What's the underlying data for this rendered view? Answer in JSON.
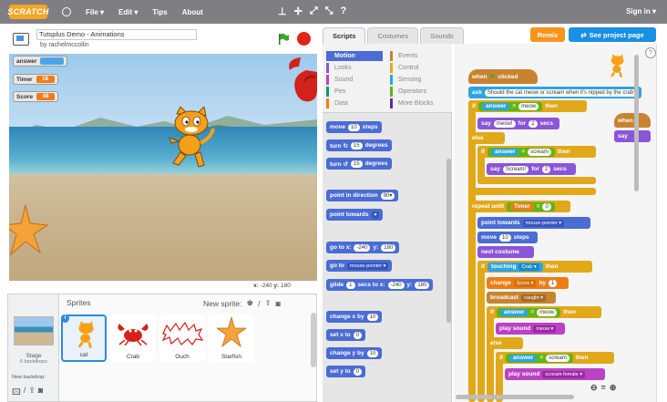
{
  "menubar": {
    "logo": "SCRATCH",
    "file": "File ▾",
    "edit": "Edit ▾",
    "tips": "Tips",
    "about": "About",
    "signin": "Sign in ▾"
  },
  "project": {
    "title": "Tutsplus Demo - Animations",
    "author": "by rachelmccollin"
  },
  "monitors": {
    "answer": "answer",
    "timer": "Timer",
    "timer_value": "18",
    "score": "Score",
    "score_value": "48"
  },
  "stage_coords": {
    "x_label": "x:",
    "x": "-240",
    "y_label": "y:",
    "y": "180"
  },
  "sprites": {
    "heading": "Sprites",
    "new_sprite": "New sprite:",
    "stage_label": "Stage",
    "stage_sub": "6 backdrops",
    "new_backdrop": "New backdrop:",
    "items": [
      {
        "name": "cat"
      },
      {
        "name": "Crab"
      },
      {
        "name": "Ouch"
      },
      {
        "name": "Starfish"
      }
    ]
  },
  "tabs": {
    "scripts": "Scripts",
    "costumes": "Costumes",
    "sounds": "Sounds"
  },
  "actions": {
    "remix": "Remix",
    "see_project": "See project page"
  },
  "categories": [
    {
      "label": "Motion",
      "color": "#4a6cd4"
    },
    {
      "label": "Events",
      "color": "#c88330"
    },
    {
      "label": "Looks",
      "color": "#8a55d7"
    },
    {
      "label": "Control",
      "color": "#e1a91a"
    },
    {
      "label": "Sound",
      "color": "#bb42c3"
    },
    {
      "label": "Sensing",
      "color": "#2ca5e2"
    },
    {
      "label": "Pen",
      "color": "#0e9a6c"
    },
    {
      "label": "Operators",
      "color": "#5cb712"
    },
    {
      "label": "Data",
      "color": "#ee7d16"
    },
    {
      "label": "More Blocks",
      "color": "#632d99"
    }
  ],
  "palette": {
    "move": "move",
    "move_val": "10",
    "steps": "steps",
    "turn_cw": "turn ↻",
    "turn_cw_val": "15",
    "degrees": "degrees",
    "turn_ccw": "turn ↺",
    "turn_ccw_val": "15",
    "point_dir": "point in direction",
    "point_dir_val": "90▾",
    "point_towards": "point towards",
    "point_towards_drop": "▾",
    "goto_xy": "go to x:",
    "goto_x": "-240",
    "goto_y_label": "y:",
    "goto_y": "180",
    "goto": "go to",
    "goto_drop": "mouse-pointer ▾",
    "glide": "glide",
    "glide_secs": "1",
    "glide_secs_label": "secs to x:",
    "glide_x": "-240",
    "glide_y_label": "y:",
    "glide_y": "180",
    "change_x": "change x by",
    "change_x_val": "10",
    "set_x": "set x to",
    "set_x_val": "0",
    "change_y": "change y by",
    "change_y_val": "10",
    "set_y": "set y to",
    "set_y_val": "0"
  },
  "script": {
    "when_flag": "when",
    "clicked": "clicked",
    "ask": "ask",
    "ask_text": "Should the cat meow or scream when it's nipped by the crab?",
    "if1": "if",
    "answer": "answer",
    "eq": "=",
    "meow": "meow",
    "then": "then",
    "say": "say",
    "say_meow": "meow!",
    "for": "for",
    "secs_val": "2",
    "secs": "secs",
    "else": "else",
    "scream": "scream",
    "say_scream": "Scream!",
    "repeat_until": "repeat until",
    "timer": "Timer",
    "timer_eq_val": "0",
    "point_towards": "point towards",
    "mouse_pointer": "mouse-pointer ▾",
    "move": "move",
    "move_val": "10",
    "steps": "steps",
    "next_costume": "next costume",
    "touching": "touching",
    "crab": "Crab ▾",
    "change": "change",
    "score": "Score ▾",
    "by": "by",
    "by_val": "1",
    "broadcast": "broadcast",
    "caught": "caught ▾",
    "play_sound": "play sound",
    "meow_drop": "meow ▾",
    "scream_female": "scream-female ▾",
    "when2": "when",
    "say2": "say"
  }
}
